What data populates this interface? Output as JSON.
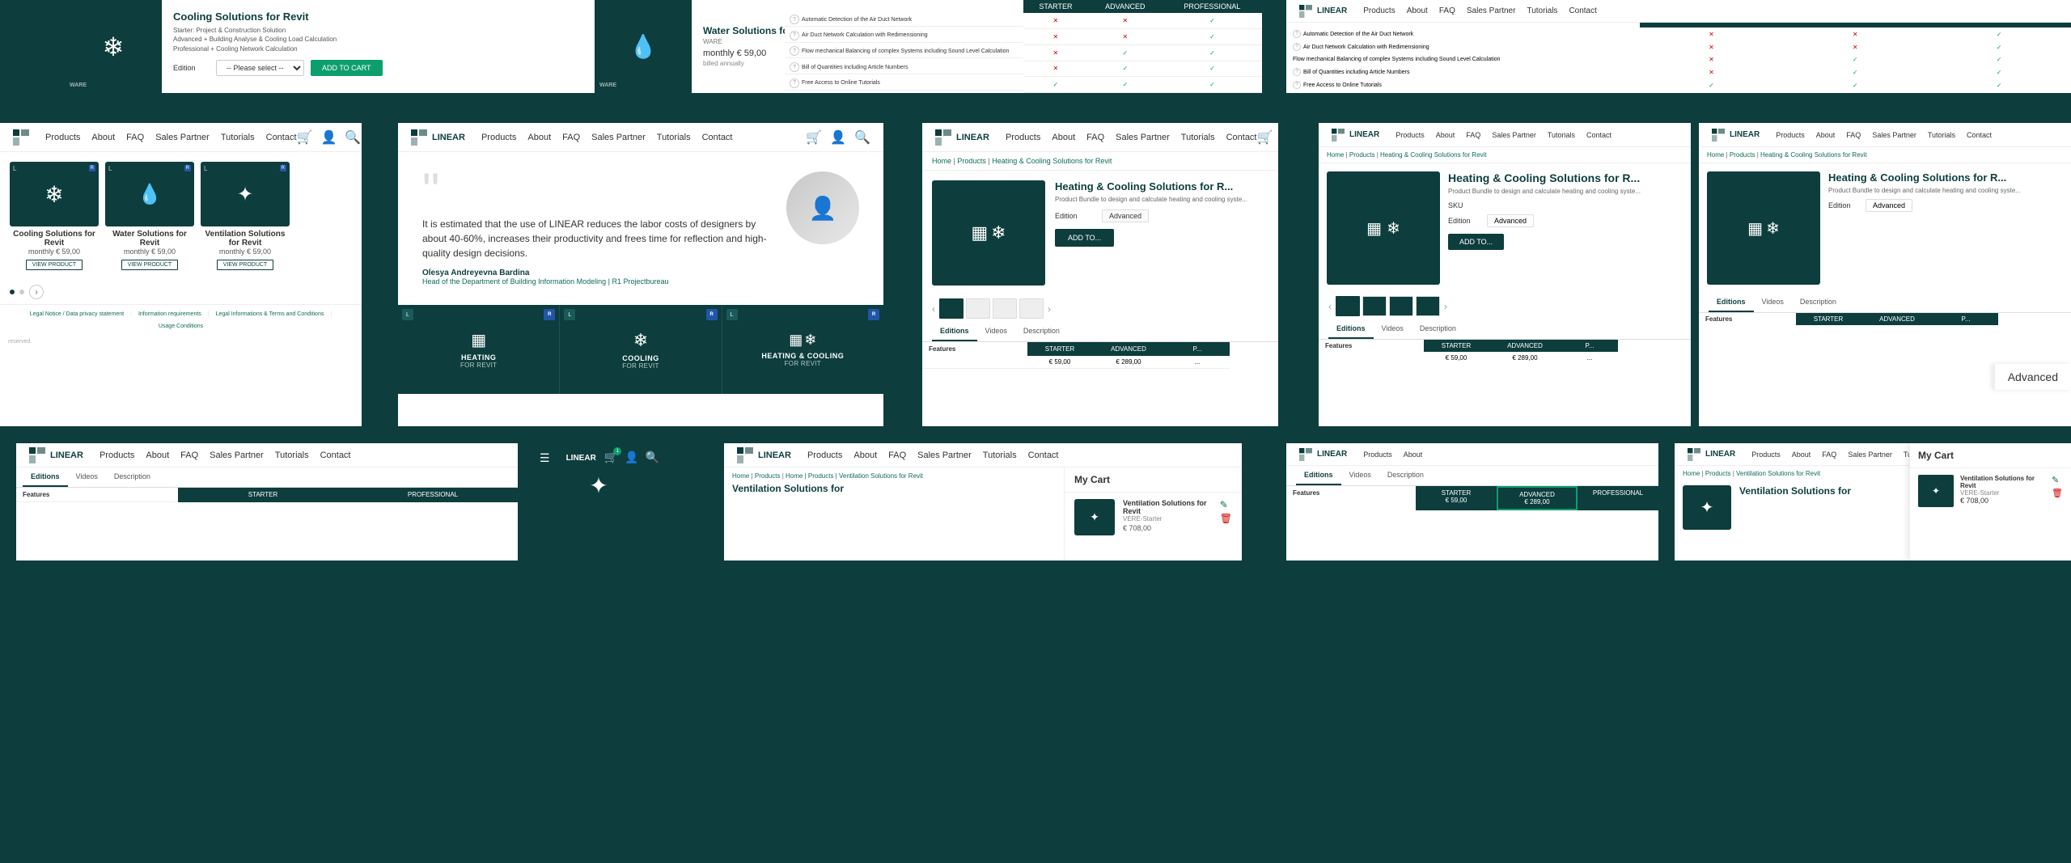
{
  "brand": {
    "name": "LINEAR",
    "logo_text": "LINEAR"
  },
  "nav": {
    "links": [
      "Products",
      "About",
      "FAQ",
      "Sales Partner",
      "Tutorials",
      "Contact"
    ]
  },
  "top_panels": {
    "panel1": {
      "product_title": "Cooling Solutions for Revit",
      "description": "Starter: Project & Construction Solution\nAdvanced + Building Analyse & Cooling Load Calculation\nProfessional + Cooling Network Calculation",
      "edition_label": "Edition",
      "edition_placeholder": "-- Please select --",
      "add_to_cart": "ADD TO CART",
      "ware_label": "WARE"
    },
    "panel2": {
      "product_title": "Water Solutions for Revit",
      "ware_label": "WARE",
      "price": "monthly € 59,00",
      "billing": "billed annually"
    },
    "panel3": {
      "features": [
        {
          "name": "Automatic Detection of the Air Duct Network",
          "starter": false,
          "advanced": true,
          "professional": true
        },
        {
          "name": "Air Duct Network Calculation with Redimensioning",
          "starter": false,
          "advanced": true,
          "professional": true
        },
        {
          "name": "Flow mechanical Balancing of complex Systems including Sound Level Calculation",
          "starter": false,
          "advanced": false,
          "professional": true
        },
        {
          "name": "Bill of Quantities including Article Numbers",
          "starter": false,
          "advanced": false,
          "professional": true
        },
        {
          "name": "Free Access to Online Tutorials",
          "starter": true,
          "advanced": true,
          "professional": true
        }
      ]
    }
  },
  "mid_panels": {
    "panel4": {
      "products": [
        {
          "name": "Cooling Solutions for Revit",
          "price": "monthly € 59,00",
          "icon": "snowflake"
        },
        {
          "name": "Water Solutions for Revit",
          "price": "monthly € 59,00",
          "icon": "droplet"
        },
        {
          "name": "Ventilation Solutions for Revit",
          "price": "monthly € 59,00",
          "icon": "fan"
        }
      ],
      "footer_links": [
        "Legal Notice / Data privacy statement",
        "Information requirements",
        "Legal Informations & Terms and Conditions",
        "Usage Conditions"
      ],
      "copyright": "reserved."
    },
    "panel5": {
      "quote": "It is estimated that the use of LINEAR reduces the labor costs of designers by about 40-60%, increases their productivity and frees time for reflection and high-quality design decisions.",
      "author": "Olesya Andreyevna Bardina",
      "role": "Head of the Department of Building Information Modeling | R1 Projectbureau",
      "product_cards": [
        {
          "label": "HEATING",
          "sublabel": "FOR REVIT",
          "icon": "radiator"
        },
        {
          "label": "COOLING",
          "sublabel": "FOR REVIT",
          "icon": "snowflake"
        },
        {
          "label": "HEATING & COOLING",
          "sublabel": "FOR REVIT",
          "icon": "heating_cooling"
        }
      ]
    },
    "panel6": {
      "breadcrumb": "Home | Products | Heating & Cooling Solutions for Revit",
      "product_title": "Heating & Cooling Solutions for R...",
      "product_desc": "Product Bundle to design and calculate heating and cooling syste...",
      "sku_label": "SKU",
      "edition_label": "Edition",
      "edition_value": "Advanced",
      "add_to_cart": "ADD TO...",
      "thumbnails": 4,
      "tabs": [
        "Editions",
        "Videos",
        "Description"
      ],
      "active_tab": "Editions",
      "editions_header": [
        "Features",
        "STARTER",
        "ADVANCED",
        "P..."
      ],
      "editions_prices": [
        "€ 59,00",
        "€ 289,00",
        "..."
      ]
    }
  },
  "bot_panels": {
    "panel7": {
      "tabs": [
        "Editions",
        "Videos",
        "Description"
      ],
      "active_tab": "Editions",
      "columns": [
        "Features",
        "STARTER",
        "PROFESSIONAL"
      ],
      "features_label": "Features"
    },
    "panel8": {
      "type": "mobile",
      "nav_links": [
        "Products",
        "About",
        "Editions"
      ]
    },
    "panel9": {
      "breadcrumb": "Home | Products | Ventilation Solutions for Revit",
      "product_title": "Ventilation Solutions for",
      "cart": {
        "title": "My Cart",
        "item_name": "Ventilation Solutions for Revit",
        "edition": "VERE-Starter",
        "price": "€ 708,00"
      }
    }
  },
  "right_panels": {
    "panel_advanced": {
      "label": "Advanced"
    },
    "panel_products_nav": {
      "nav_links": [
        "Products",
        "About",
        "FAQ",
        "Sales Partner",
        "Tutorials",
        "Contact"
      ],
      "breadcrumb": "Home | Products | Heating & Cooling Solutions for Revit"
    },
    "panel_testimonial_nav": {
      "nav_links": [
        "Products",
        "About",
        "FAQ",
        "Sales Partner",
        "Tutorials",
        "Contact"
      ]
    },
    "panel_editions_bottom": {
      "nav_links": [
        "Products",
        "About"
      ]
    }
  },
  "icons": {
    "snowflake": "❄",
    "droplet": "💧",
    "fan": "✦",
    "radiator": "▦",
    "cart": "🛒",
    "user": "👤",
    "search": "🔍",
    "chevron_left": "‹",
    "chevron_right": "›",
    "check": "✓",
    "cross": "✕",
    "question": "?",
    "hamburger": "☰",
    "pencil": "✎",
    "trash": "🗑"
  },
  "colors": {
    "teal_dark": "#0d3d3d",
    "teal_mid": "#0d6b5a",
    "teal_light": "#0d9e6e",
    "white": "#ffffff",
    "gray_light": "#eeeeee",
    "gray_mid": "#999999",
    "text_dark": "#333333",
    "text_mid": "#555555",
    "check_green": "#0d9e6e",
    "cross_red": "#cc0000",
    "blue_revit": "#2255aa"
  }
}
